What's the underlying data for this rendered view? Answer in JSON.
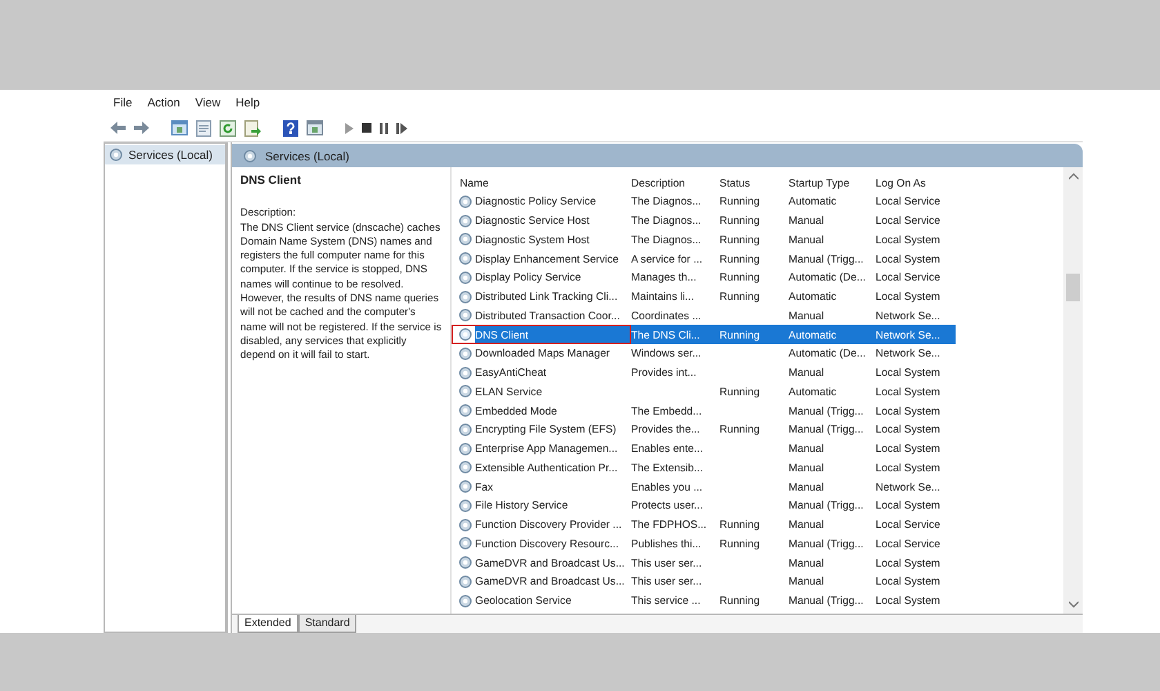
{
  "menu": [
    "File",
    "Action",
    "View",
    "Help"
  ],
  "tree": {
    "label": "Services (Local)",
    "selected": true
  },
  "pane_header": "Services (Local)",
  "details": {
    "title": "DNS Client",
    "label": "Description:",
    "text": "The DNS Client service (dnscache) caches Domain Name System (DNS) names and registers the full computer name for this computer. If the service is stopped, DNS names will continue to be resolved. However, the results of DNS name queries will not be cached and the computer's name will not be registered. If the service is disabled, any services that explicitly depend on it will fail to start."
  },
  "table": {
    "columns": [
      "Name",
      "Description",
      "Status",
      "Startup Type",
      "Log On As"
    ],
    "rows": [
      {
        "name": "Diagnostic Policy Service",
        "description": "The Diagnos...",
        "status": "Running",
        "startup": "Automatic",
        "logon": "Local Service",
        "selected": false,
        "highlighted": false
      },
      {
        "name": "Diagnostic Service Host",
        "description": "The Diagnos...",
        "status": "Running",
        "startup": "Manual",
        "logon": "Local Service",
        "selected": false,
        "highlighted": false
      },
      {
        "name": "Diagnostic System Host",
        "description": "The Diagnos...",
        "status": "Running",
        "startup": "Manual",
        "logon": "Local System",
        "selected": false,
        "highlighted": false
      },
      {
        "name": "Display Enhancement Service",
        "description": "A service for ...",
        "status": "Running",
        "startup": "Manual (Trigg...",
        "logon": "Local System",
        "selected": false,
        "highlighted": false
      },
      {
        "name": "Display Policy Service",
        "description": "Manages th...",
        "status": "Running",
        "startup": "Automatic (De...",
        "logon": "Local Service",
        "selected": false,
        "highlighted": false
      },
      {
        "name": "Distributed Link Tracking Cli...",
        "description": "Maintains li...",
        "status": "Running",
        "startup": "Automatic",
        "logon": "Local System",
        "selected": false,
        "highlighted": false
      },
      {
        "name": "Distributed Transaction Coor...",
        "description": "Coordinates ...",
        "startup": "Manual",
        "logon": "Network Se...",
        "selected": false,
        "highlighted": false
      },
      {
        "name": "DNS Client",
        "description": "The DNS Cli...",
        "status": "Running",
        "startup": "Automatic",
        "logon": "Network Se...",
        "selected": true,
        "highlighted": true
      },
      {
        "name": "Downloaded Maps Manager",
        "description": "Windows ser...",
        "startup": "Automatic (De...",
        "logon": "Network Se...",
        "selected": false,
        "highlighted": false
      },
      {
        "name": "EasyAntiCheat",
        "description": "Provides int...",
        "startup": "Manual",
        "logon": "Local System",
        "selected": false,
        "highlighted": false
      },
      {
        "name": "ELAN Service",
        "status": "Running",
        "startup": "Automatic",
        "logon": "Local System",
        "selected": false,
        "highlighted": false
      },
      {
        "name": "Embedded Mode",
        "description": "The Embedd...",
        "startup": "Manual (Trigg...",
        "logon": "Local System",
        "selected": false,
        "highlighted": false
      },
      {
        "name": "Encrypting File System (EFS)",
        "description": "Provides the...",
        "status": "Running",
        "startup": "Manual (Trigg...",
        "logon": "Local System",
        "selected": false,
        "highlighted": false
      },
      {
        "name": "Enterprise App Managemen...",
        "description": "Enables ente...",
        "startup": "Manual",
        "logon": "Local System",
        "selected": false,
        "highlighted": false
      },
      {
        "name": "Extensible Authentication Pr...",
        "description": "The Extensib...",
        "startup": "Manual",
        "logon": "Local System",
        "selected": false,
        "highlighted": false
      },
      {
        "name": "Fax",
        "description": "Enables you ...",
        "startup": "Manual",
        "logon": "Network Se...",
        "selected": false,
        "highlighted": false
      },
      {
        "name": "File History Service",
        "description": "Protects user...",
        "startup": "Manual (Trigg...",
        "logon": "Local System",
        "selected": false,
        "highlighted": false
      },
      {
        "name": "Function Discovery Provider ...",
        "description": "The FDPHOS...",
        "status": "Running",
        "startup": "Manual",
        "logon": "Local Service",
        "selected": false,
        "highlighted": false
      },
      {
        "name": "Function Discovery Resourc...",
        "description": "Publishes thi...",
        "status": "Running",
        "startup": "Manual (Trigg...",
        "logon": "Local Service",
        "selected": false,
        "highlighted": false
      },
      {
        "name": "GameDVR and Broadcast Us...",
        "description": "This user ser...",
        "startup": "Manual",
        "logon": "Local System",
        "selected": false,
        "highlighted": false
      },
      {
        "name": "GameDVR and Broadcast Us...",
        "description": "This user ser...",
        "startup": "Manual",
        "logon": "Local System",
        "selected": false,
        "highlighted": false
      },
      {
        "name": "Geolocation Service",
        "description": "This service ...",
        "status": "Running",
        "startup": "Manual (Trigg...",
        "logon": "Local System",
        "selected": false,
        "highlighted": false
      }
    ]
  },
  "view_tabs": [
    {
      "label": "Extended",
      "selected": true
    },
    {
      "label": "Standard",
      "selected": false
    }
  ]
}
